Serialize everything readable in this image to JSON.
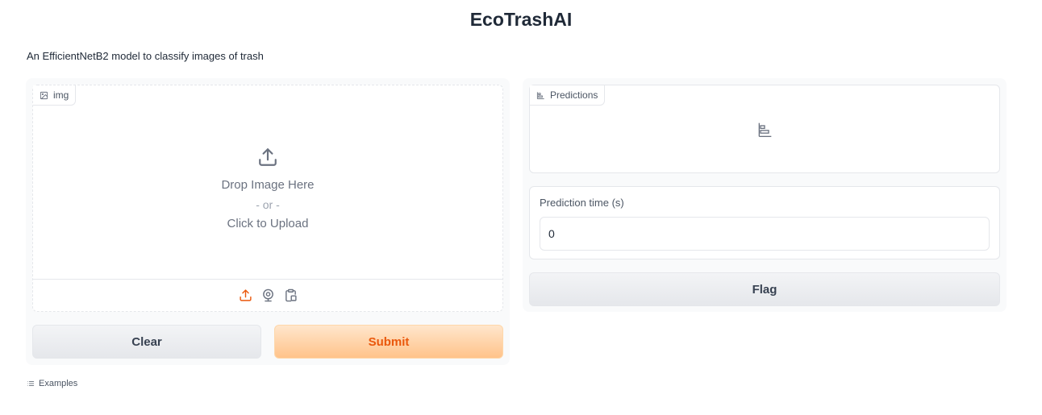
{
  "app": {
    "title": "EcoTrashAI",
    "description": "An EfficientNetB2 model to classify images of trash"
  },
  "input_panel": {
    "image": {
      "label": "img",
      "label_icon": "image-icon",
      "drop_text": "Drop Image Here",
      "or_text": "- or -",
      "click_text": "Click to Upload",
      "sources": [
        {
          "name": "upload",
          "icon": "upload-icon",
          "active": true
        },
        {
          "name": "webcam",
          "icon": "webcam-icon",
          "active": false
        },
        {
          "name": "clipboard",
          "icon": "clipboard-icon",
          "active": false
        }
      ]
    },
    "clear_label": "Clear",
    "submit_label": "Submit"
  },
  "output_panel": {
    "predictions_label": "Predictions",
    "predictions_icon": "bar-chart-icon",
    "time_label": "Prediction time (s)",
    "time_value": "0",
    "flag_label": "Flag"
  },
  "examples_label": "Examples",
  "colors": {
    "accent": "#ea580c",
    "submit_bg_top": "#ffe6cc",
    "submit_bg_bottom": "#ffc38a",
    "panel_bg": "#f9fafb",
    "border": "#e5e7eb"
  }
}
